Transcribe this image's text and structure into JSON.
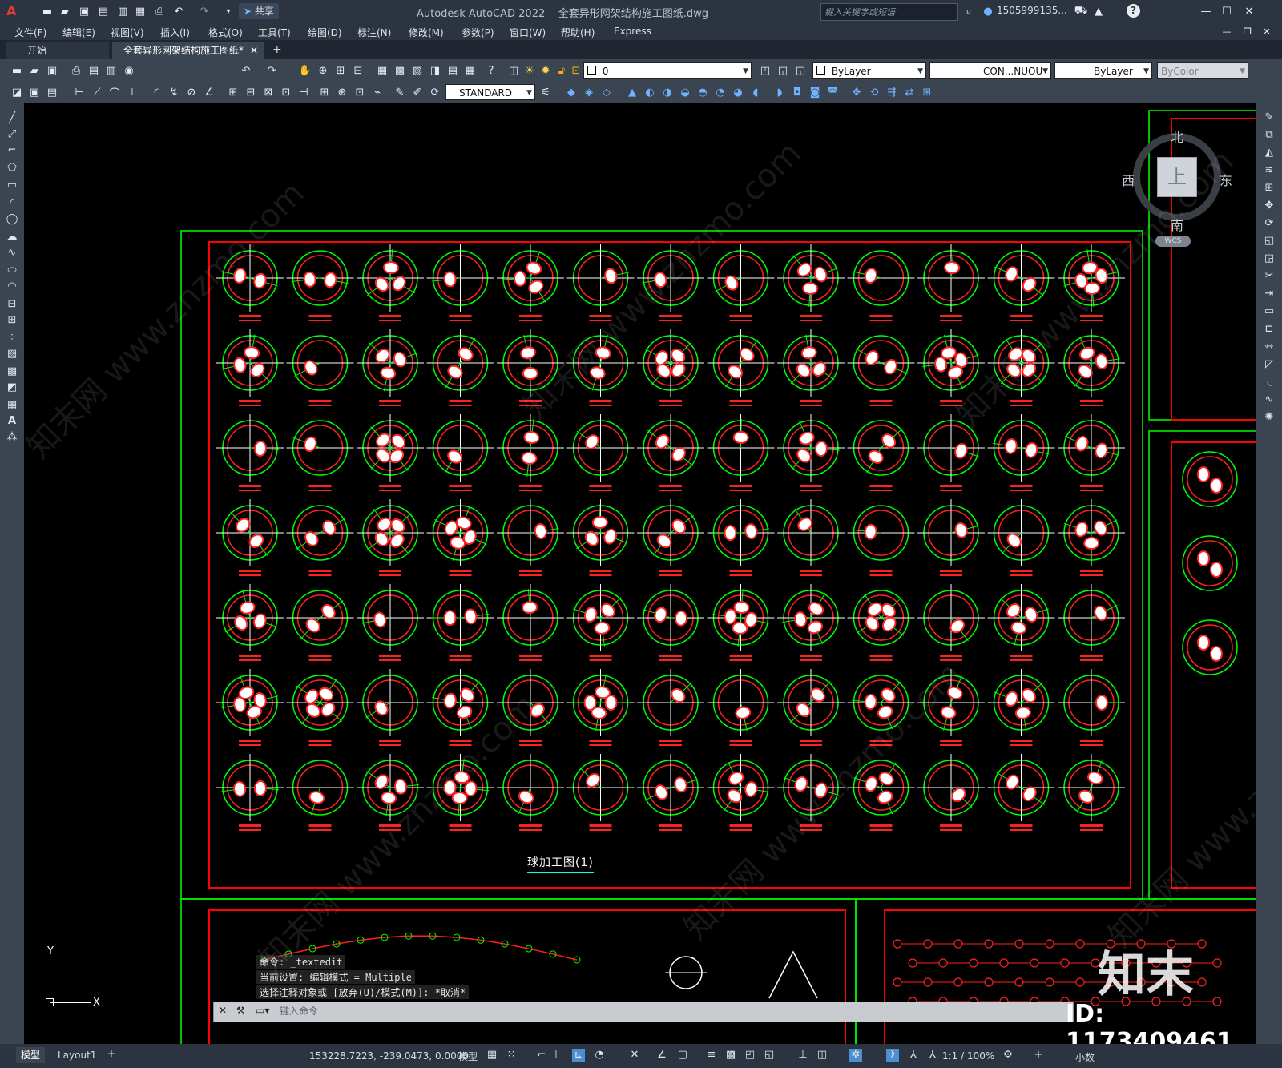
{
  "titlebar": {
    "app_title": "Autodesk AutoCAD 2022    全套异形网架结构施工图纸.dwg",
    "share_label": "共享",
    "search_placeholder": "键入关键字或短语",
    "user": "1505999135...",
    "help": "?"
  },
  "menubar": [
    "文件(F)",
    "编辑(E)",
    "视图(V)",
    "插入(I)",
    "格式(O)",
    "工具(T)",
    "绘图(D)",
    "标注(N)",
    "修改(M)",
    "参数(P)",
    "窗口(W)",
    "帮助(H)",
    "Express"
  ],
  "tabs": {
    "start": "开始",
    "active": "全套异形网架结构施工图纸*",
    "add": "+"
  },
  "toolbar": {
    "layer_value": "0",
    "color_value": "ByLayer",
    "linetype_value": "CON...NUOU",
    "lineweight_value": "ByLayer",
    "plotstyle_value": "ByColor",
    "textstyle_value": "STANDARD"
  },
  "viewcube": {
    "north": "北",
    "south": "南",
    "east": "东",
    "west": "西",
    "face": "上",
    "wcs": "WCS"
  },
  "drawing": {
    "caption": "球加工图(1)",
    "grid_rows": 7,
    "grid_cols": 13,
    "colors": {
      "frame_green": "#00ff00",
      "frame_red": "#ff0000",
      "node_green": "#00ff00",
      "node_red": "#ff2020"
    }
  },
  "command": {
    "line1": "命令: _textedit",
    "line2": "当前设置: 编辑模式 = Multiple",
    "line3": "选择注释对象或 [放弃(U)/模式(M)]: *取消*",
    "input_placeholder": "键入命令"
  },
  "ucs": {
    "x": "X",
    "y": "Y"
  },
  "layout_tabs": {
    "model": "模型",
    "layout1": "Layout1",
    "add": "+"
  },
  "status": {
    "coords": "153228.7223, -239.0473, 0.0000",
    "mode": "模型",
    "scale": "1:1 / 100%",
    "units": "小数"
  },
  "watermark": {
    "brand": "知末",
    "id": "ID: 1173409461",
    "site": "知末网 www.znzmo.com"
  }
}
